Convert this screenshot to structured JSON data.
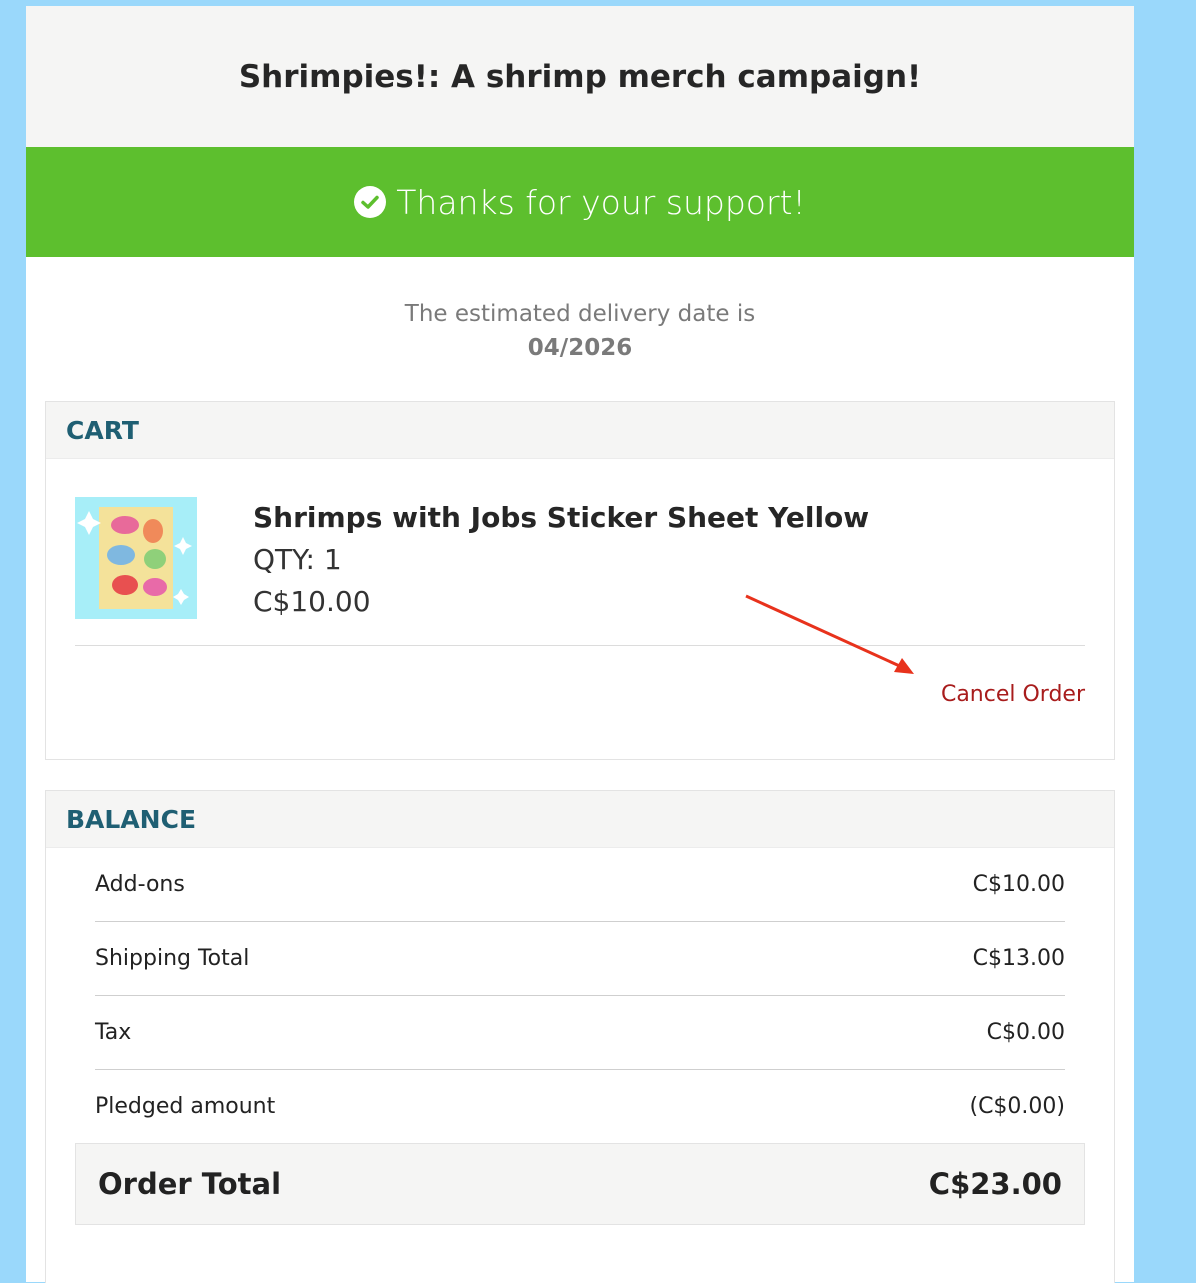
{
  "campaign_title": "Shrimpies!: A shrimp merch campaign!",
  "banner": {
    "message": "Thanks for your support!"
  },
  "delivery": {
    "text": "The estimated delivery date is",
    "date": "04/2026"
  },
  "cart": {
    "heading": "CART",
    "item": {
      "name": "Shrimps with Jobs Sticker Sheet Yellow",
      "qty": "QTY: 1",
      "price": "C$10.00"
    },
    "cancel_label": "Cancel Order"
  },
  "balance": {
    "heading": "BALANCE",
    "rows": [
      {
        "label": "Add-ons",
        "value": "C$10.00"
      },
      {
        "label": "Shipping Total",
        "value": "C$13.00"
      },
      {
        "label": "Tax",
        "value": "C$0.00"
      },
      {
        "label": "Pledged amount",
        "value": "(C$0.00)"
      }
    ],
    "total_label": "Order Total",
    "total_value": "C$23.00"
  },
  "colors": {
    "banner": "#5dbf2e",
    "heading": "#1f5f73",
    "cancel": "#a81c1c",
    "annotation_arrow": "#e8321c"
  }
}
